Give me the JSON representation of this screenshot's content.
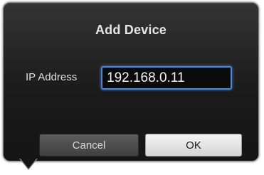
{
  "dialog": {
    "title": "Add Device",
    "ip_label": "IP Address",
    "ip_value": "192.168.0.11",
    "cancel_label": "Cancel",
    "ok_label": "OK"
  },
  "colors": {
    "dialog_background": "#1b1b1b",
    "focus_ring": "#4f86d6",
    "ok_button": "#e6e6e6",
    "cancel_button": "#4a4a4a"
  }
}
